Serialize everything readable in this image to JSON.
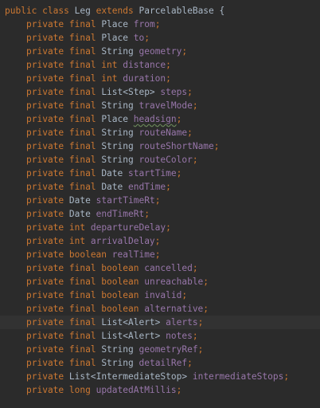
{
  "editor": {
    "header": {
      "kw1": "public",
      "kw2": "class",
      "class_name": "Leg",
      "kw3": "extends",
      "parent": "ParcelableBase",
      "brace": "{"
    },
    "lines": [
      {
        "mods": "private final",
        "type": "Place",
        "name": "from"
      },
      {
        "mods": "private final",
        "type": "Place",
        "name": "to"
      },
      {
        "mods": "private final",
        "type": "String",
        "name": "geometry"
      },
      {
        "mods": "private final int",
        "type": "",
        "name": "distance"
      },
      {
        "mods": "private final int",
        "type": "",
        "name": "duration"
      },
      {
        "mods": "private final",
        "type": "List<Step>",
        "name": "steps"
      },
      {
        "mods": "private final",
        "type": "String",
        "name": "travelMode"
      },
      {
        "mods": "private final",
        "type": "Place",
        "name": "headsign"
      },
      {
        "mods": "private final",
        "type": "String",
        "name": "routeName"
      },
      {
        "mods": "private final",
        "type": "String",
        "name": "routeShortName"
      },
      {
        "mods": "private final",
        "type": "String",
        "name": "routeColor"
      },
      {
        "mods": "private final",
        "type": "Date",
        "name": "startTime"
      },
      {
        "mods": "private final",
        "type": "Date",
        "name": "endTime"
      },
      {
        "mods": "private",
        "type": "Date",
        "name": "startTimeRt"
      },
      {
        "mods": "private",
        "type": "Date",
        "name": "endTimeRt"
      },
      {
        "mods": "private int",
        "type": "",
        "name": "departureDelay"
      },
      {
        "mods": "private int",
        "type": "",
        "name": "arrivalDelay"
      },
      {
        "mods": "private boolean",
        "type": "",
        "name": "realTime"
      },
      {
        "mods": "private final boolean",
        "type": "",
        "name": "cancelled"
      },
      {
        "mods": "private final boolean",
        "type": "",
        "name": "unreachable"
      },
      {
        "mods": "private final boolean",
        "type": "",
        "name": "invalid"
      },
      {
        "mods": "private final boolean",
        "type": "",
        "name": "alternative"
      },
      {
        "mods": "private final",
        "type": "List<Alert>",
        "name": "alerts"
      },
      {
        "mods": "private final",
        "type": "List<Alert>",
        "name": "notes"
      },
      {
        "mods": "private final",
        "type": "String",
        "name": "geometryRef"
      },
      {
        "mods": "private final",
        "type": "String",
        "name": "detailRef"
      },
      {
        "mods": "private",
        "type": "List<IntermediateStop>",
        "name": "intermediateStops"
      },
      {
        "mods": "private long",
        "type": "",
        "name": "updatedAtMillis"
      }
    ],
    "semicolon": ";"
  },
  "colors": {
    "background": "#2b2b2b",
    "current_line": "#323232",
    "keyword": "#cc7832",
    "plain": "#a9b7c6",
    "field": "#9876aa",
    "warning_underline": "#6a8759"
  }
}
